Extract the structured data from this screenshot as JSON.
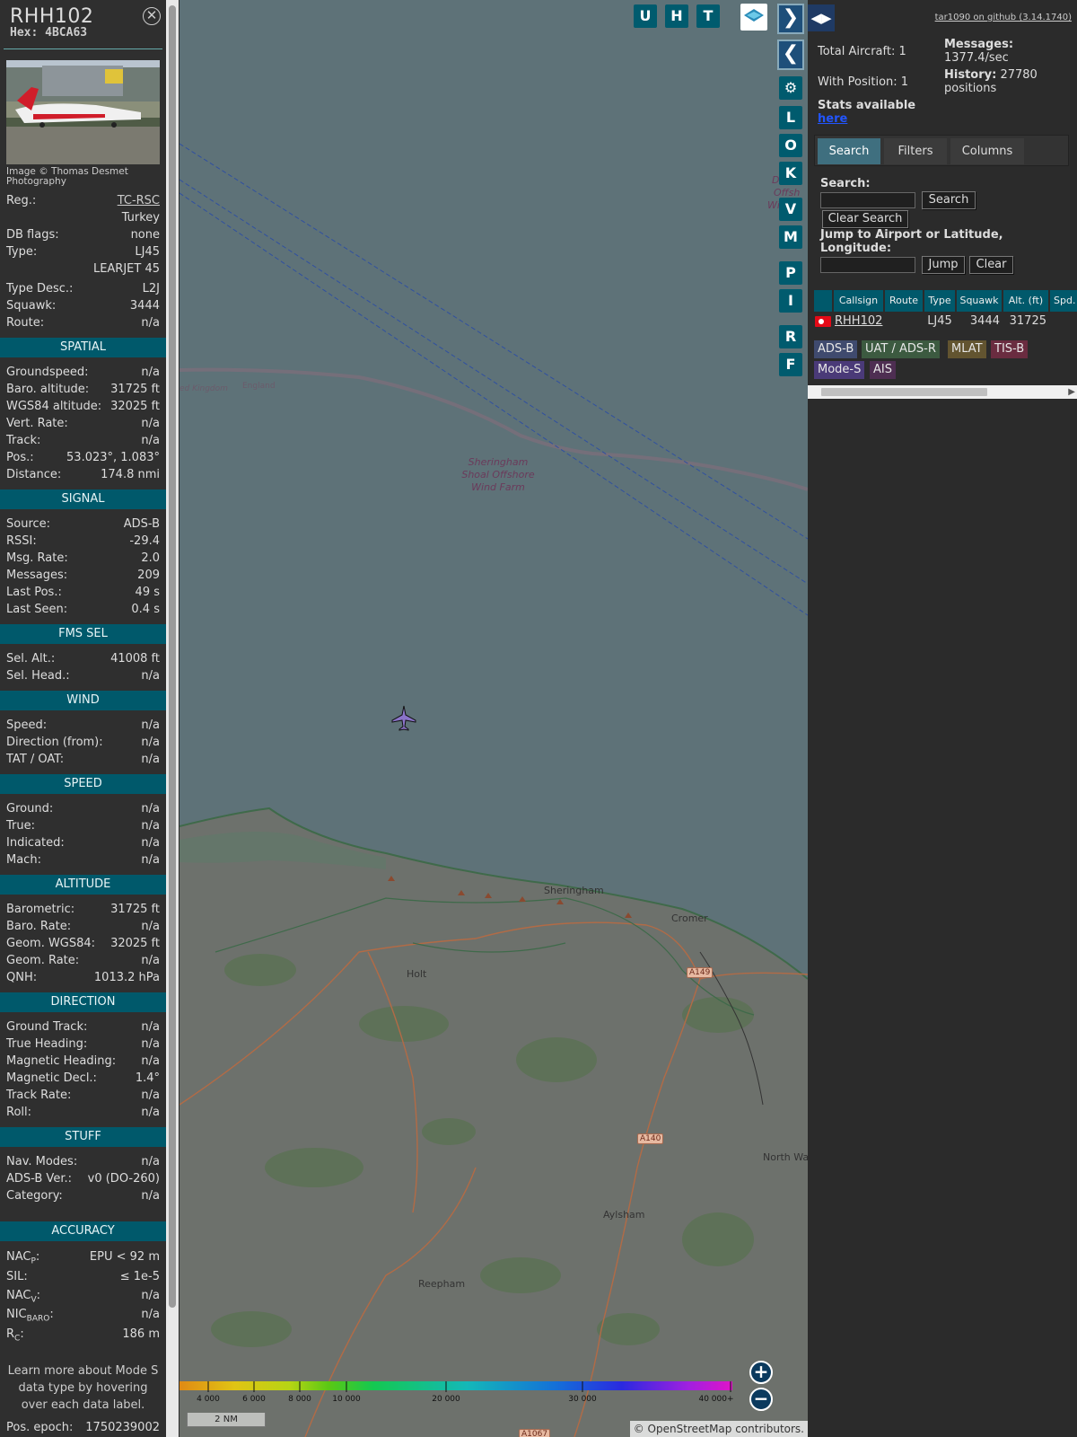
{
  "aircraft": {
    "callsign": "RHH102",
    "hex_label": "Hex:",
    "hex": "4BCA63",
    "photo_credit": "Image © Thomas Desmet Photography",
    "reg_label": "Reg.:",
    "reg": "TC-RSC",
    "country": "Turkey",
    "dbflags_label": "DB flags:",
    "dbflags": "none",
    "type_label": "Type:",
    "type": "LJ45",
    "type_name": "LEARJET 45",
    "typedesc_label": "Type Desc.:",
    "typedesc": "L2J",
    "squawk_label": "Squawk:",
    "squawk": "3444",
    "route_label": "Route:",
    "route": "n/a"
  },
  "sections": {
    "spatial": "SPATIAL",
    "signal": "SIGNAL",
    "fms": "FMS SEL",
    "wind": "WIND",
    "speed": "SPEED",
    "altitude": "ALTITUDE",
    "direction": "DIRECTION",
    "stuff": "STUFF",
    "accuracy": "ACCURACY"
  },
  "spatial": [
    {
      "k": "Groundspeed:",
      "v": "n/a"
    },
    {
      "k": "Baro. altitude:",
      "v": "31725 ft"
    },
    {
      "k": "WGS84 altitude:",
      "v": "32025 ft"
    },
    {
      "k": "Vert. Rate:",
      "v": "n/a"
    },
    {
      "k": "Track:",
      "v": "n/a"
    },
    {
      "k": "Pos.:",
      "v": "53.023°, 1.083°"
    },
    {
      "k": "Distance:",
      "v": "174.8 nmi"
    }
  ],
  "signal": [
    {
      "k": "Source:",
      "v": "ADS-B"
    },
    {
      "k": "RSSI:",
      "v": "-29.4"
    },
    {
      "k": "Msg. Rate:",
      "v": "2.0"
    },
    {
      "k": "Messages:",
      "v": "209"
    },
    {
      "k": "Last Pos.:",
      "v": "49 s"
    },
    {
      "k": "Last Seen:",
      "v": "0.4 s"
    }
  ],
  "fms": [
    {
      "k": "Sel. Alt.:",
      "v": "41008 ft"
    },
    {
      "k": "Sel. Head.:",
      "v": "n/a"
    }
  ],
  "wind": [
    {
      "k": "Speed:",
      "v": "n/a"
    },
    {
      "k": "Direction (from):",
      "v": "n/a"
    },
    {
      "k": "TAT / OAT:",
      "v": "n/a"
    }
  ],
  "speed": [
    {
      "k": "Ground:",
      "v": "n/a"
    },
    {
      "k": "True:",
      "v": "n/a"
    },
    {
      "k": "Indicated:",
      "v": "n/a"
    },
    {
      "k": "Mach:",
      "v": "n/a"
    }
  ],
  "altitude": [
    {
      "k": "Barometric:",
      "v": "31725 ft"
    },
    {
      "k": "Baro. Rate:",
      "v": "n/a"
    },
    {
      "k": "Geom. WGS84:",
      "v": "32025 ft"
    },
    {
      "k": "Geom. Rate:",
      "v": "n/a"
    },
    {
      "k": "QNH:",
      "v": "1013.2 hPa"
    }
  ],
  "direction": [
    {
      "k": "Ground Track:",
      "v": "n/a"
    },
    {
      "k": "True Heading:",
      "v": "n/a"
    },
    {
      "k": "Magnetic Heading:",
      "v": "n/a"
    },
    {
      "k": "Magnetic Decl.:",
      "v": "1.4°"
    },
    {
      "k": "Track Rate:",
      "v": "n/a"
    },
    {
      "k": "Roll:",
      "v": "n/a"
    }
  ],
  "stuff": [
    {
      "k": "Nav. Modes:",
      "v": "n/a"
    },
    {
      "k": "ADS-B Ver.:",
      "v": "v0 (DO-260)"
    },
    {
      "k": "Category:",
      "v": "n/a"
    }
  ],
  "accuracy": {
    "nacp_k": "NAC",
    "nacp_sub": "P",
    "nacp_v": "EPU < 92 m",
    "sil_k": "SIL:",
    "sil_v": "≤ 1e-5",
    "nacv_k": "NAC",
    "nacv_sub": "V",
    "nacv_v": "n/a",
    "nic_k": "NIC",
    "nic_sub": "BARO",
    "nic_v": "n/a",
    "rc_k": "R",
    "rc_sub": "C",
    "rc_v": "186 m"
  },
  "note": "Learn more about Mode S data type by hovering over each data label.",
  "pos_epoch_label": "Pos. epoch:",
  "pos_epoch": "1750239002",
  "map": {
    "buttons_top": [
      "U",
      "H",
      "T"
    ],
    "side_buttons": [
      "L",
      "O",
      "K",
      "V",
      "M",
      "P",
      "I",
      "R",
      "F"
    ],
    "labels": {
      "uk": "ed Kingdom",
      "england": "England",
      "windfarm1": "Sheringham",
      "windfarm2": "Shoal Offshore",
      "windfarm3": "Wind Farm",
      "dudg1": "D",
      "dudg2": "Offsh",
      "dudg3": "Wi",
      "sheringham": "Sheringham",
      "cromer": "Cromer",
      "holt": "Holt",
      "aylsham": "Aylsham",
      "reepham": "Reepham",
      "northwal": "North Wa"
    },
    "roads": [
      "A149",
      "A140",
      "A1067"
    ],
    "scale": "2 NM",
    "attribution": "© OpenStreetMap contributors.",
    "colorbar_labels": [
      "4 000",
      "6 000",
      "8 000",
      "10 000",
      "20 000",
      "30 000",
      "40 000+"
    ]
  },
  "right": {
    "github": "tar1090 on github (3.14.1740)",
    "total_aircraft": "Total Aircraft: 1",
    "with_position": "With Position: 1",
    "messages_label": "Messages:",
    "messages_value": "1377.4/sec",
    "history_label": "History:",
    "history_value": "27780",
    "history_unit": "positions",
    "stats_label": "Stats available",
    "stats_link": "here",
    "tabs": [
      "Search",
      "Filters",
      "Columns"
    ],
    "search_label": "Search:",
    "search_button": "Search",
    "clear_search_button": "Clear Search",
    "jump_label": "Jump to Airport or Latitude, Longitude:",
    "jump_button": "Jump",
    "clear_button": "Clear",
    "table_headers": [
      "Callsign",
      "Route",
      "Type",
      "Squawk",
      "Alt. (ft)",
      "Spd."
    ],
    "table_row": {
      "callsign": "RHH102",
      "route": "",
      "type": "LJ45",
      "squawk": "3444",
      "alt": "31725"
    },
    "sources": [
      "ADS-B",
      "UAT / ADS-R",
      "MLAT",
      "TIS-B",
      "Mode-S",
      "AIS"
    ]
  }
}
